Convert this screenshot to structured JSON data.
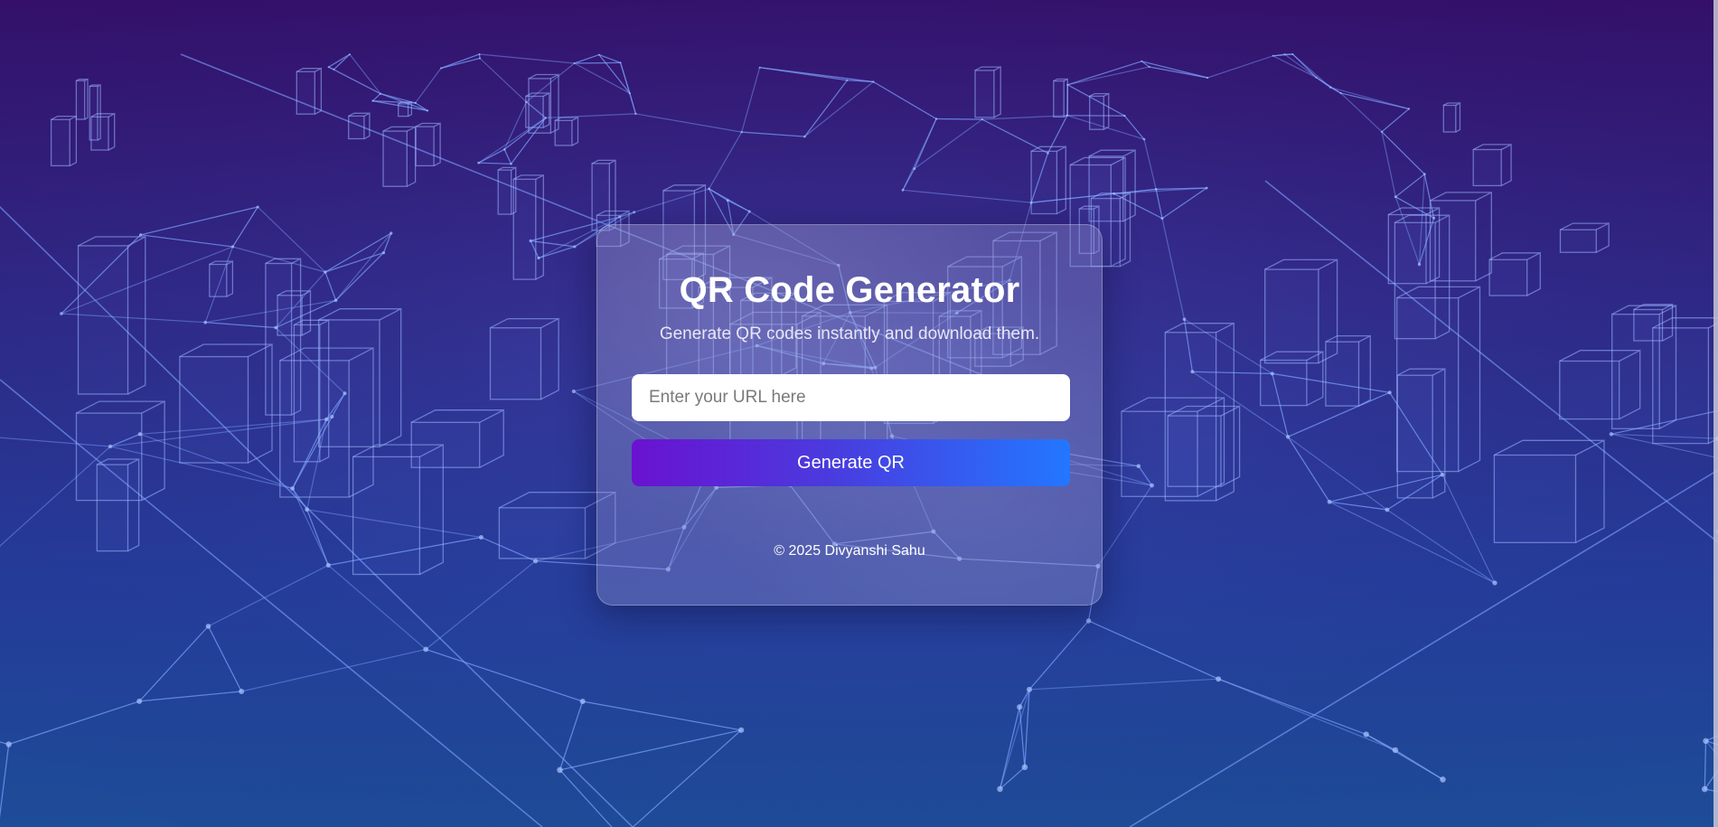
{
  "app": {
    "title": "QR Code Generator",
    "subtitle": "Generate QR codes instantly and download them."
  },
  "form": {
    "url_placeholder": "Enter your URL here",
    "url_value": "",
    "generate_label": "Generate QR"
  },
  "footer": {
    "copyright": "© 2025 Divyanshi Sahu"
  },
  "colors": {
    "background_top": "#34106a",
    "background_bottom": "#1d4c98",
    "wireframe": "#7ea3ff",
    "button_gradient_start": "#6a12d0",
    "button_gradient_end": "#2377ff"
  }
}
